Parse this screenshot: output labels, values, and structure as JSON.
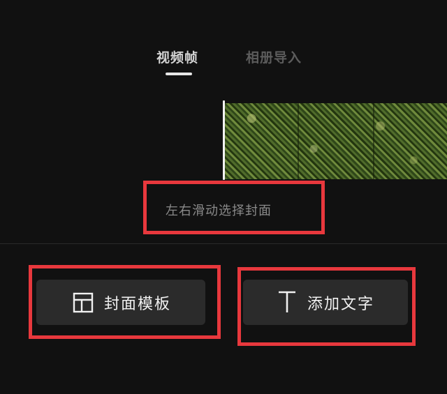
{
  "tabs": [
    {
      "label": "视频帧",
      "active": true
    },
    {
      "label": "相册导入",
      "active": false
    }
  ],
  "timeline": {
    "hint": "左右滑动选择封面"
  },
  "actions": {
    "cover_template_label": "封面模板",
    "add_text_label": "添加文字"
  },
  "colors": {
    "background": "#111111",
    "button_bg": "#2b2b2b",
    "highlight_border": "#e8383d"
  },
  "icons": {
    "cover_template": "layout-template-icon",
    "add_text": "text-t-icon"
  }
}
